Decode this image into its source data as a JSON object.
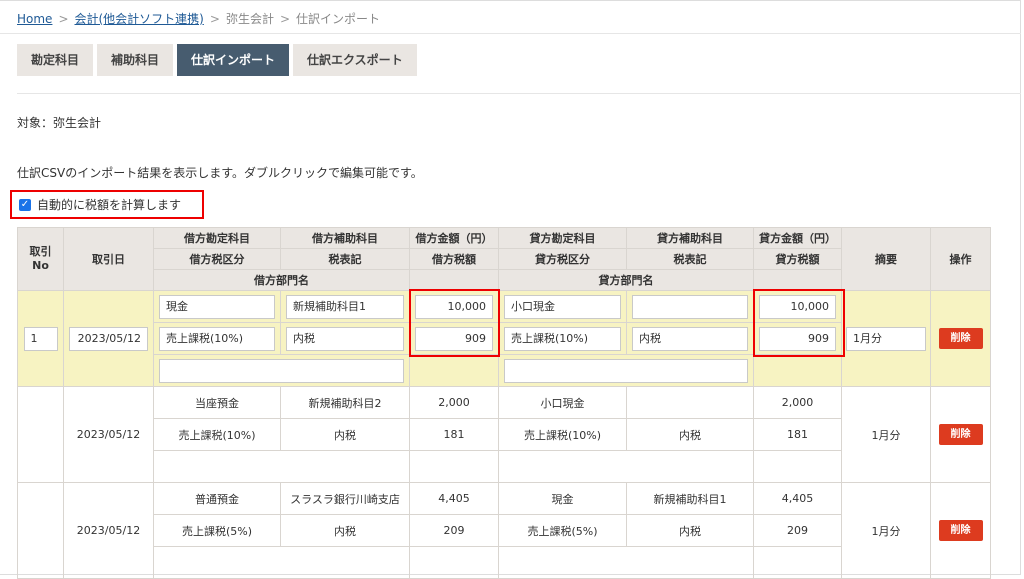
{
  "breadcrumb": {
    "home": "Home",
    "parent": "会計(他会計ソフト連携)",
    "yayoi": "弥生会計",
    "current": "仕訳インポート",
    "sep": ">"
  },
  "tabs": [
    {
      "label": "勘定科目"
    },
    {
      "label": "補助科目"
    },
    {
      "label": "仕訳インポート",
      "active": true
    },
    {
      "label": "仕訳エクスポート"
    }
  ],
  "target_label": "対象：弥生会計",
  "description": "仕訳CSVのインポート結果を表示します。ダブルクリックで編集可能です。",
  "auto_calc": {
    "label": "自動的に税額を計算します",
    "checked": true
  },
  "headers": {
    "no": "取引\nNo",
    "date": "取引日",
    "debit_account": "借方勘定科目",
    "debit_sub": "借方補助科目",
    "debit_amount": "借方金額（円）",
    "credit_account": "貸方勘定科目",
    "credit_sub": "貸方補助科目",
    "credit_amount": "貸方金額（円）",
    "memo": "摘要",
    "action": "操作",
    "debit_tax_class": "借方税区分",
    "debit_tax_note": "税表記",
    "debit_tax": "借方税額",
    "credit_tax_class": "貸方税区分",
    "credit_tax_note": "税表記",
    "credit_tax": "貸方税額",
    "debit_dept": "借方部門名",
    "credit_dept": "貸方部門名"
  },
  "rows": [
    {
      "no": "1",
      "date": "2023/05/12",
      "debit_account": "現金",
      "debit_sub": "新規補助科目1",
      "debit_amount": "10,000",
      "credit_account": "小口現金",
      "credit_sub": "",
      "credit_amount": "10,000",
      "debit_tax_class": "売上課税(10%)",
      "debit_tax_note": "内税",
      "debit_tax": "909",
      "credit_tax_class": "売上課税(10%)",
      "credit_tax_note": "内税",
      "credit_tax": "909",
      "memo": "1月分",
      "debit_dept": "",
      "credit_dept": "",
      "delete": "削除"
    },
    {
      "no": "",
      "date": "2023/05/12",
      "debit_account": "当座預金",
      "debit_sub": "新規補助科目2",
      "debit_amount": "2,000",
      "credit_account": "小口現金",
      "credit_sub": "",
      "credit_amount": "2,000",
      "debit_tax_class": "売上課税(10%)",
      "debit_tax_note": "内税",
      "debit_tax": "181",
      "credit_tax_class": "売上課税(10%)",
      "credit_tax_note": "内税",
      "credit_tax": "181",
      "memo": "1月分",
      "delete": "削除"
    },
    {
      "no": "",
      "date": "2023/05/12",
      "debit_account": "普通預金",
      "debit_sub": "スラスラ銀行川崎支店",
      "debit_amount": "4,405",
      "credit_account": "現金",
      "credit_sub": "新規補助科目1",
      "credit_amount": "4,405",
      "debit_tax_class": "売上課税(5%)",
      "debit_tax_note": "内税",
      "debit_tax": "209",
      "credit_tax_class": "売上課税(5%)",
      "credit_tax_note": "内税",
      "credit_tax": "209",
      "memo": "1月分",
      "delete": "削除"
    }
  ],
  "colors": {
    "tab_active": "#475c6f",
    "tab": "#eae6e2",
    "edit_row": "#f7f3c2",
    "delete": "#dd3b1f",
    "highlight": "#ee0000"
  }
}
